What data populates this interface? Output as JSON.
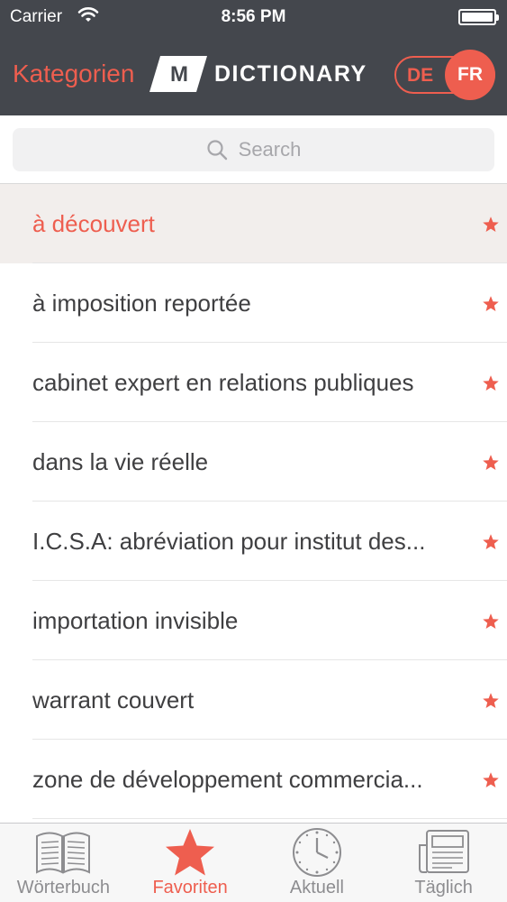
{
  "status_bar": {
    "carrier": "Carrier",
    "time": "8:56 PM",
    "wifi_icon": "wifi-icon",
    "battery_icon": "battery-icon"
  },
  "nav": {
    "back_label": "Kategorien",
    "logo_letter": "M",
    "logo_word": "DICTIONARY",
    "lang_left": "DE",
    "lang_right": "FR",
    "lang_active": "FR"
  },
  "search": {
    "placeholder": "Search",
    "icon": "search-icon"
  },
  "list": {
    "selected_index": 0,
    "items": [
      {
        "label": "à découvert",
        "favorite": true
      },
      {
        "label": "à imposition reportée",
        "favorite": true
      },
      {
        "label": "cabinet expert en relations publiques",
        "favorite": true
      },
      {
        "label": "dans la vie réelle",
        "favorite": true
      },
      {
        "label": "I.C.S.A: abréviation pour institut des...",
        "favorite": true
      },
      {
        "label": "importation invisible",
        "favorite": true
      },
      {
        "label": "warrant couvert",
        "favorite": true
      },
      {
        "label": "zone de développement commercia...",
        "favorite": true
      }
    ]
  },
  "tabbar": {
    "active": "Favoriten",
    "tabs": [
      {
        "label": "Wörterbuch",
        "icon": "book-icon"
      },
      {
        "label": "Favoriten",
        "icon": "star-icon"
      },
      {
        "label": "Aktuell",
        "icon": "clock-icon"
      },
      {
        "label": "Täglich",
        "icon": "newspaper-icon"
      }
    ]
  },
  "colors": {
    "accent": "#ee5e4f",
    "header_bg": "#44474d",
    "text": "#3f3f41",
    "tab_inactive": "#8d8d90",
    "selected_row_bg": "#f2eeec"
  }
}
